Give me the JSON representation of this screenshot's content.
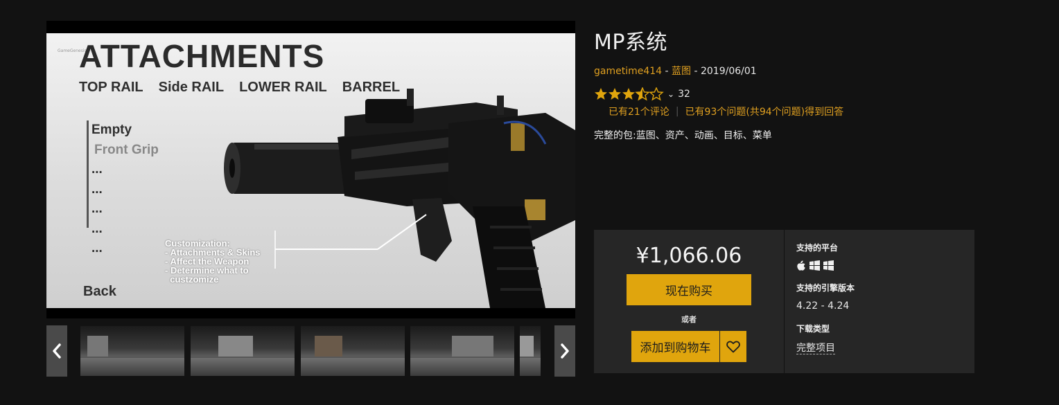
{
  "viewer": {
    "att_title": "ATTACHMENTS",
    "rails": [
      "TOP RAIL",
      "Side RAIL",
      "LOWER RAIL",
      "BARREL"
    ],
    "menu": [
      "Empty",
      "Front Grip",
      "...",
      "...",
      "...",
      "...",
      "..."
    ],
    "back": "Back",
    "custom_lines": [
      "Customization:",
      "- Attachments & Skins",
      "- Affect the Weapon",
      "- Determine what to",
      "  custzomize"
    ]
  },
  "thumbnails": [
    "thumb-1",
    "thumb-2",
    "thumb-3",
    "thumb-4",
    "thumb-5"
  ],
  "product": {
    "title": "MP系统",
    "author": "gametime414",
    "sep1": " - ",
    "category": "蓝图",
    "sep2": " - ",
    "date": "2019/06/01",
    "rating": 3.5,
    "rating_count": "32",
    "reviews": "已有21个评论",
    "questions": "已有93个问题(共94个问题)得到回答",
    "package": "完整的包:蓝图、资产、动画、目标、菜单"
  },
  "purchase": {
    "price": "¥1,066.06",
    "buy_label": "现在购买",
    "or_label": "或者",
    "cart_label": "添加到购物车"
  },
  "specs": {
    "platforms_label": "支持的平台",
    "platform_icons": [
      "apple-icon",
      "windows-icon",
      "windows-icon"
    ],
    "engine_label": "支持的引擎版本",
    "engine_versions": "4.22 - 4.24",
    "download_label": "下载类型",
    "download_type": "完整项目"
  },
  "colors": {
    "background": "#121212",
    "accent": "#e0a50d",
    "link": "#e0a020",
    "panel": "#262626"
  }
}
